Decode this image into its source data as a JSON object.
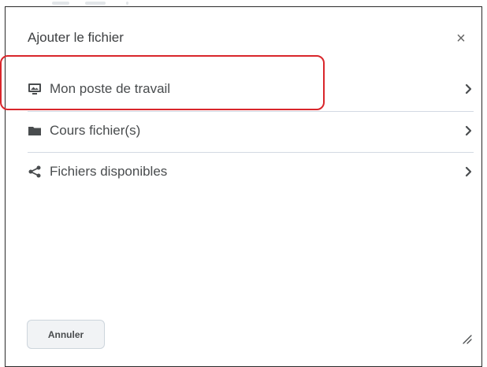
{
  "dialog": {
    "title": "Ajouter le fichier",
    "close_label": "×"
  },
  "sources": [
    {
      "label": "Mon poste de travail",
      "icon": "monitor-icon"
    },
    {
      "label": "Cours fichier(s)",
      "icon": "folder-icon"
    },
    {
      "label": "Fichiers disponibles",
      "icon": "share-icon"
    }
  ],
  "footer": {
    "cancel_label": "Annuler"
  },
  "colors": {
    "highlight": "#d9262b",
    "text": "#494c4e",
    "separator": "#d3d9e3"
  }
}
